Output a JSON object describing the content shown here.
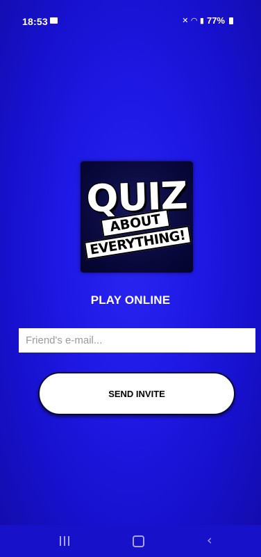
{
  "status_bar": {
    "time": "18:53",
    "battery": "77%",
    "icons": [
      "gallery-icon",
      "mute-icon",
      "wifi-icon",
      "signal-icon",
      "battery-icon"
    ]
  },
  "logo": {
    "line1": "QUIZ",
    "line2": "ABOUT",
    "line3": "EVERYTHING!"
  },
  "main": {
    "heading": "PLAY ONLINE",
    "email_placeholder": "Friend's e-mail...",
    "email_value": "",
    "send_button_label": "SEND INVITE"
  },
  "nav_bar": {
    "icons": [
      "recent-apps-icon",
      "home-icon",
      "back-icon"
    ]
  },
  "colors": {
    "background": "#1f19e6",
    "button": "#ffffff",
    "text": "#ffffff"
  }
}
